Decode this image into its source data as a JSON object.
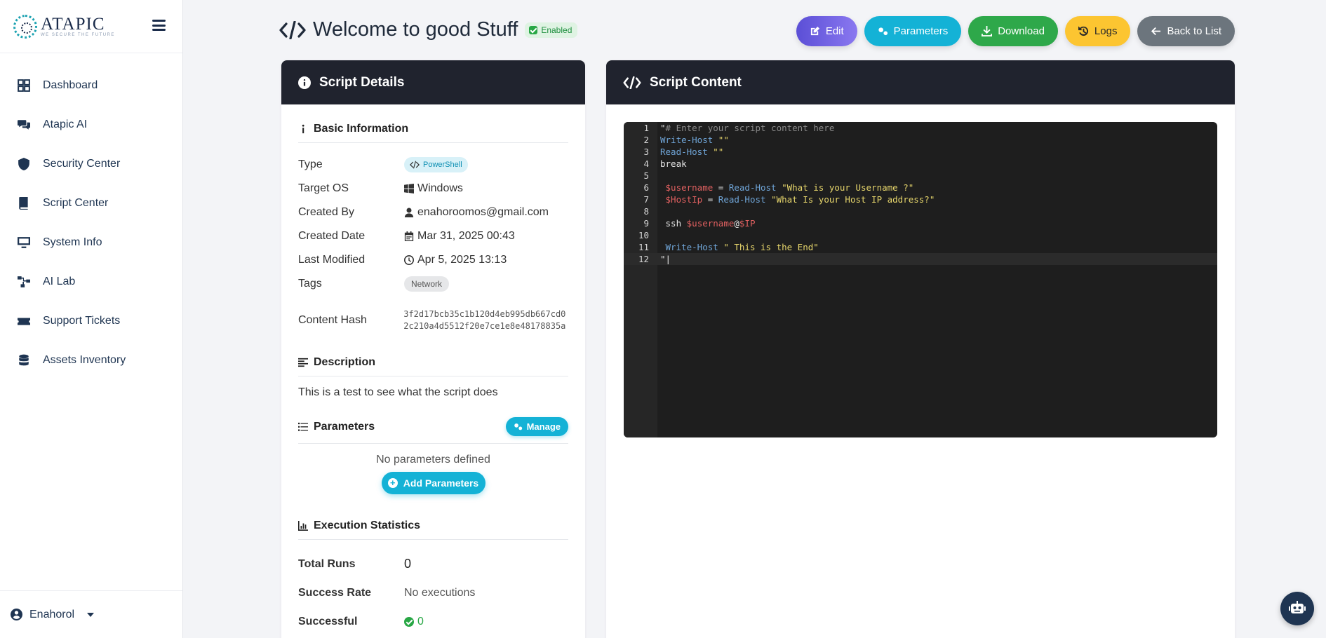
{
  "brand": {
    "name": "ATAPIC",
    "tagline": "WE SECURE THE FUTURE"
  },
  "sidebar": {
    "items": [
      {
        "label": "Dashboard",
        "icon": "grid-icon"
      },
      {
        "label": "Atapic AI",
        "icon": "chat-icon"
      },
      {
        "label": "Security Center",
        "icon": "shield-icon"
      },
      {
        "label": "Script Center",
        "icon": "book-icon"
      },
      {
        "label": "System Info",
        "icon": "monitor-icon"
      },
      {
        "label": "AI Lab",
        "icon": "network-icon"
      },
      {
        "label": "Support Tickets",
        "icon": "ticket-icon"
      },
      {
        "label": "Assets Inventory",
        "icon": "database-icon"
      }
    ],
    "user": "Enahorol"
  },
  "header": {
    "title": "Welcome to good Stuff",
    "status": "Enabled",
    "buttons": {
      "edit": "Edit",
      "parameters": "Parameters",
      "download": "Download",
      "logs": "Logs",
      "back": "Back to List"
    }
  },
  "details": {
    "title": "Script Details",
    "basic_title": "Basic Information",
    "labels": {
      "type": "Type",
      "target_os": "Target OS",
      "created_by": "Created By",
      "created_date": "Created Date",
      "last_modified": "Last Modified",
      "tags": "Tags",
      "content_hash": "Content Hash"
    },
    "values": {
      "type": "PowerShell",
      "target_os": "Windows",
      "created_by": "enahoroomos@gmail.com",
      "created_date": "Mar 31, 2025 00:43",
      "last_modified": "Apr 5, 2025 13:13",
      "tag": "Network",
      "content_hash": "3f2d17bcb35c1b120d4eb995db667cd02c210a4d5512f20e7ce1e8e48178835a"
    },
    "description_title": "Description",
    "description": "This is a test to see what the script does",
    "parameters_title": "Parameters",
    "manage_label": "Manage",
    "no_params": "No parameters defined",
    "add_params_label": "Add Parameters",
    "stats_title": "Execution Statistics",
    "stats": {
      "total_runs_label": "Total Runs",
      "total_runs": "0",
      "success_rate_label": "Success Rate",
      "success_rate": "No executions",
      "successful_label": "Successful",
      "successful": "0"
    }
  },
  "script": {
    "title": "Script Content",
    "lines": [
      {
        "n": "1",
        "tokens": [
          [
            "plain",
            "\""
          ],
          [
            "comment",
            "# Enter your script content here"
          ]
        ]
      },
      {
        "n": "2",
        "tokens": [
          [
            "cmd",
            "Write-Host"
          ],
          [
            "plain",
            " "
          ],
          [
            "str",
            "\"\""
          ]
        ]
      },
      {
        "n": "3",
        "tokens": [
          [
            "cmd",
            "Read-Host"
          ],
          [
            "plain",
            " "
          ],
          [
            "str",
            "\"\""
          ]
        ]
      },
      {
        "n": "4",
        "tokens": [
          [
            "plain",
            "break"
          ]
        ]
      },
      {
        "n": "5",
        "tokens": []
      },
      {
        "n": "6",
        "tokens": [
          [
            "plain",
            " "
          ],
          [
            "var",
            "$username"
          ],
          [
            "plain",
            " = "
          ],
          [
            "cmd",
            "Read-Host"
          ],
          [
            "plain",
            " "
          ],
          [
            "str",
            "\"What is your Username ?\""
          ]
        ]
      },
      {
        "n": "7",
        "tokens": [
          [
            "plain",
            " "
          ],
          [
            "var",
            "$HostIp"
          ],
          [
            "plain",
            " = "
          ],
          [
            "cmd",
            "Read-Host"
          ],
          [
            "plain",
            " "
          ],
          [
            "str",
            "\"What Is your Host IP address?\""
          ]
        ]
      },
      {
        "n": "8",
        "tokens": []
      },
      {
        "n": "9",
        "tokens": [
          [
            "plain",
            " ssh "
          ],
          [
            "var",
            "$username"
          ],
          [
            "plain",
            "@"
          ],
          [
            "var",
            "$IP"
          ]
        ]
      },
      {
        "n": "10",
        "tokens": []
      },
      {
        "n": "11",
        "tokens": [
          [
            "plain",
            " "
          ],
          [
            "cmd",
            "Write-Host"
          ],
          [
            "plain",
            " "
          ],
          [
            "str",
            "\" This is the End\""
          ]
        ]
      },
      {
        "n": "12",
        "tokens": [
          [
            "plain",
            "\"|"
          ]
        ]
      }
    ]
  },
  "colors": {
    "accent": "#14b2d6",
    "dark_header": "#20232e",
    "success": "#28a745",
    "edit": "#6a5ce0",
    "logs": "#fcc531",
    "back": "#6c757d"
  }
}
